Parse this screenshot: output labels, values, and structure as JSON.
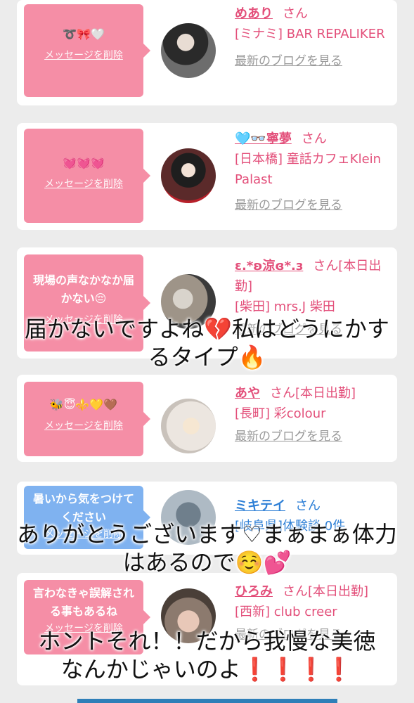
{
  "cards": [
    {
      "message": "➰🎀🤍",
      "delete": "メッセージを削除",
      "name": "めあり",
      "san": "さん",
      "shop": "[ミナミ] BAR REPALIKER",
      "blog": "最新のブログを見る"
    },
    {
      "message": "💓💓💓",
      "delete": "メッセージを削除",
      "name": "🩵👓寧夢",
      "san": "さん",
      "shop": "[日本橋] 童話カフェKlein Palast",
      "blog": "最新のブログを見る"
    },
    {
      "message": "現場の声なかなか届かない😔",
      "delete": "メッセージを削除",
      "name": "ε.*ʚ涼ɞ*.з",
      "san": "さん[本日出勤]",
      "shop": "[柴田] mrs.J 柴田",
      "blog": "最新のブログを見る"
    },
    {
      "message": "🐝😇⚜️💛🤎",
      "delete": "メッセージを削除",
      "name": "あや",
      "san": "さん[本日出勤]",
      "shop": "[長町] 彩colour",
      "blog": "最新のブログを見る"
    },
    {
      "message": "暑いから気をつけてください",
      "delete": "メッセージを削除",
      "name": "ミキテイ",
      "san": "さん",
      "shop": "[岐阜県]体験談 0件",
      "blog": ""
    },
    {
      "message": "言わなきゃ誤解される事もあるね",
      "delete": "メッセージを削除",
      "name": "ひろみ",
      "san": "さん[本日出勤]",
      "shop": "[西新] club creer",
      "blog": "最新のブログを見る"
    }
  ],
  "overlays": [
    "届かないですよね💔私はどうにかするタイプ🔥",
    "ありがとうございます♡まぁまぁ体力はあるので☺️💕",
    "ホントそれ！！だから我慢な美徳なんかじゃいのよ❗️❗️❗️❗️"
  ],
  "colors": {
    "bubble_pink": "#f58ea6",
    "bubble_blue": "#7fb2f0",
    "name_pink": "#e34f7a",
    "name_blue": "#2d7fd6",
    "page_bg": "#ececec"
  }
}
